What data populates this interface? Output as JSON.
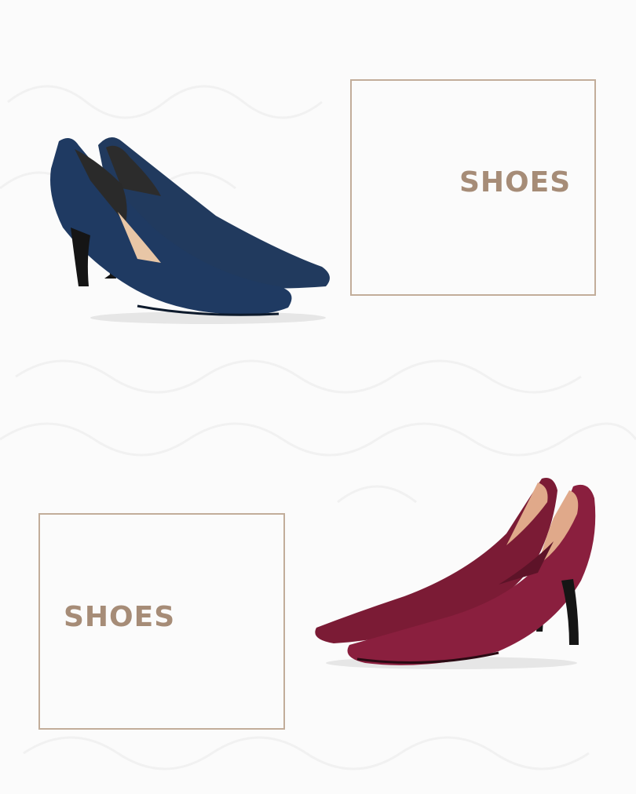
{
  "top_panel": {
    "label": "SHOES",
    "shoe": {
      "name": "navy-pump",
      "color": "#20385c"
    }
  },
  "bottom_panel": {
    "label": "SHOES",
    "shoe": {
      "name": "burgundy-pump",
      "color": "#7a1b35"
    }
  },
  "colors": {
    "background": "#fbfbfb",
    "frame": "#c2ad9a",
    "label": "#a68c77"
  }
}
